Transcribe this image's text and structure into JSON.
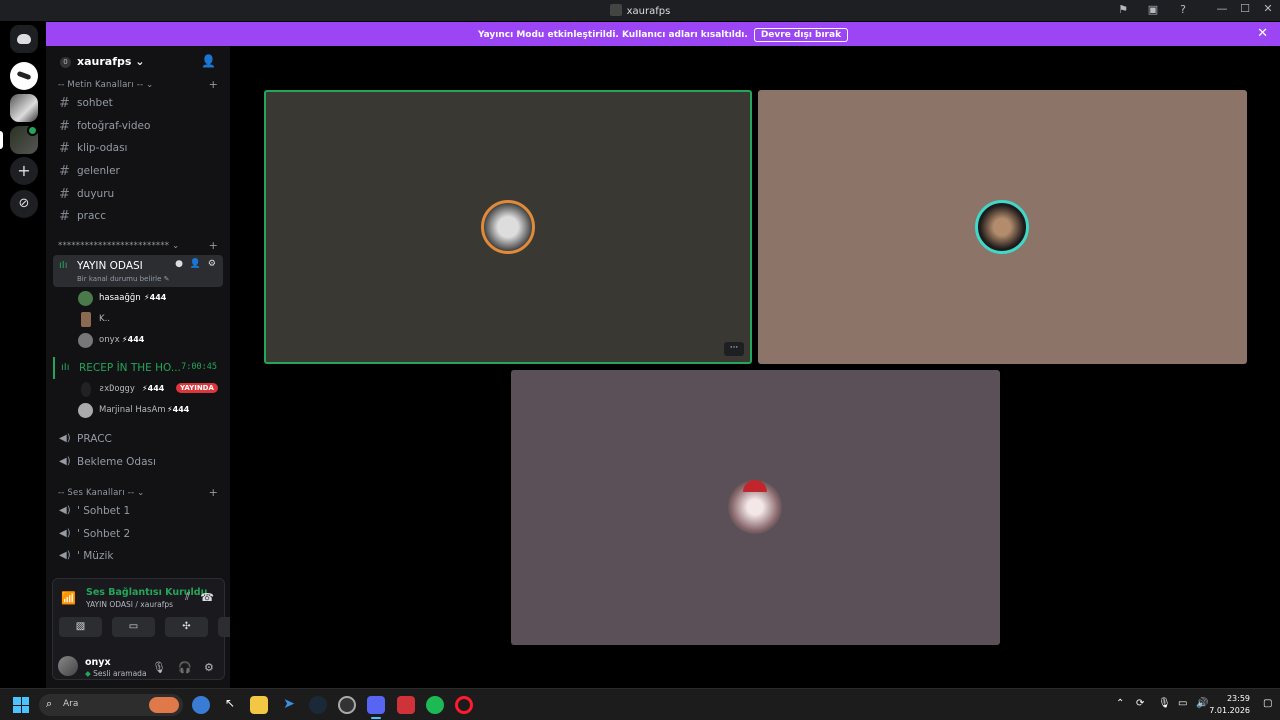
{
  "window": {
    "title": "xaurafps"
  },
  "banner": {
    "message": "Yayıncı Modu etkinleştirildi. Kullanıcı adları kısaltıldı.",
    "button": "Devre dışı bırak",
    "color": "#9b45f5"
  },
  "server": {
    "name": "xaurafps",
    "badge": "0"
  },
  "categories": {
    "text": "-- Metin Kanalları --",
    "stars": "*************************",
    "voice": "-- Ses Kanalları --"
  },
  "text_channels": [
    "sohbet",
    "fotoğraf-video",
    "klip-odası",
    "gelenler",
    "duyuru",
    "pracc"
  ],
  "active_voice": {
    "name": "YAYIN ODASI",
    "status": "Bir kanal durumu belirle",
    "users": [
      {
        "name": "hasaağğn",
        "tag": "444"
      },
      {
        "name": "K..",
        "tag": ""
      },
      {
        "name": "onyx",
        "tag": "444"
      }
    ]
  },
  "voice2": {
    "name": "RECEP İN THE HO...",
    "timer": "7:00:45",
    "users": [
      {
        "name": "ƨxDoggy",
        "tag": "444",
        "live": "YAYINDA"
      },
      {
        "name": "Marjinal HasAm",
        "tag": "444",
        "live": ""
      }
    ]
  },
  "other_voice": [
    "PRACC",
    "Bekleme Odası"
  ],
  "voice_channels": [
    "' Sohbet 1",
    "' Sohbet 2",
    "' Müzik"
  ],
  "voice_panel": {
    "title": "Ses Bağlantısı Kuruldu",
    "subtitle": "YAYIN ODASI / xaurafps"
  },
  "user": {
    "name": "onyx",
    "status": "Sesli aramada"
  },
  "taskbar": {
    "search_label": "Ara",
    "time": "23:59",
    "date": "7.01.2026"
  },
  "colors": {
    "speaking": "#23a55a",
    "live": "#da373c",
    "accent": "#4cc2ff"
  }
}
